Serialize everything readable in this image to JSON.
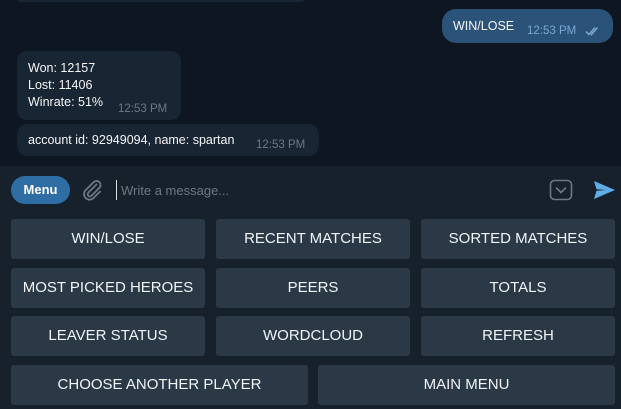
{
  "messages": {
    "outgoing": {
      "text": "WIN/LOSE",
      "time": "12:53 PM",
      "status": "read"
    },
    "stats": {
      "won": "Won: 12157",
      "lost": "Lost: 11406",
      "winrate": "Winrate: 51%",
      "time": "12:53 PM"
    },
    "account": {
      "text": "account id: 92949094, name: spartan",
      "time": "12:53 PM"
    }
  },
  "input_bar": {
    "menu_label": "Menu",
    "placeholder": "Write a message...",
    "value": ""
  },
  "keyboard": {
    "rows": [
      [
        "WIN/LOSE",
        "RECENT MATCHES",
        "SORTED MATCHES"
      ],
      [
        "MOST PICKED HEROES",
        "PEERS",
        "TOTALS"
      ],
      [
        "LEAVER STATUS",
        "WORDCLOUD",
        "REFRESH"
      ],
      [
        "CHOOSE ANOTHER PLAYER",
        "MAIN MENU"
      ]
    ]
  },
  "colors": {
    "chat_bg": "#0e1621",
    "panel_bg": "#17212b",
    "incoming_bubble": "#182533",
    "outgoing_bubble": "#2b5278",
    "accent": "#2f6ea5",
    "send_icon": "#5eaee8",
    "keyboard_button": "#2b3947"
  },
  "icons": {
    "attach": "paperclip-icon",
    "keyboard_toggle": "keyboard-toggle-icon",
    "send": "send-icon",
    "read_status": "double-check-icon"
  }
}
